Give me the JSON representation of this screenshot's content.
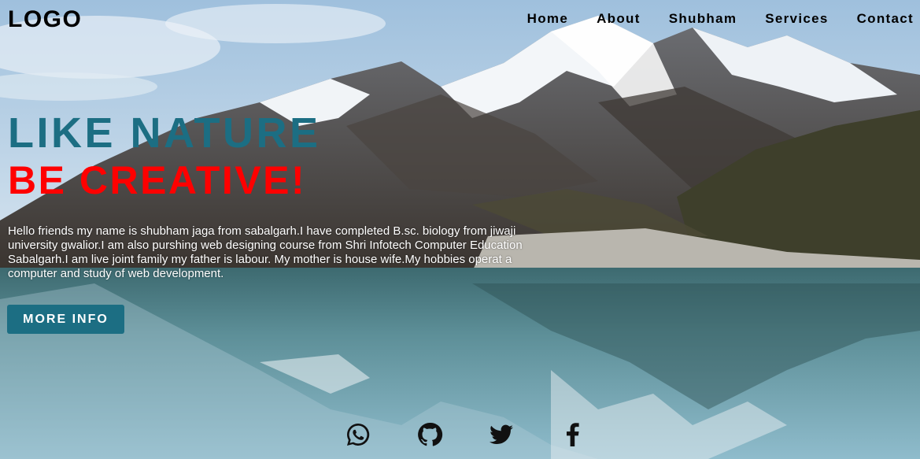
{
  "header": {
    "logo": "LOGO",
    "nav": [
      "Home",
      "About",
      "Shubham",
      "Services",
      "Contact"
    ]
  },
  "hero": {
    "headline_primary": "LIKE NATURE",
    "headline_secondary": "BE CREATIVE!",
    "intro": "Hello friends my name is shubham jaga from sabalgarh.I have completed B.sc. biology from jiwaji university gwalior.I am also purshing web designing course from Shri Infotech Computer Education Sabalgarh.I am live joint family my father is labour. My mother is house wife.My hobbies operat a computer and study of web development.",
    "button_label": "MORE INFO"
  },
  "social": [
    {
      "icon": "whatsapp-icon"
    },
    {
      "icon": "github-icon"
    },
    {
      "icon": "twitter-icon"
    },
    {
      "icon": "facebook-icon"
    }
  ],
  "colors": {
    "accent": "#1c6e83",
    "headline_red": "#ff0000",
    "nav_text": "#000000"
  }
}
